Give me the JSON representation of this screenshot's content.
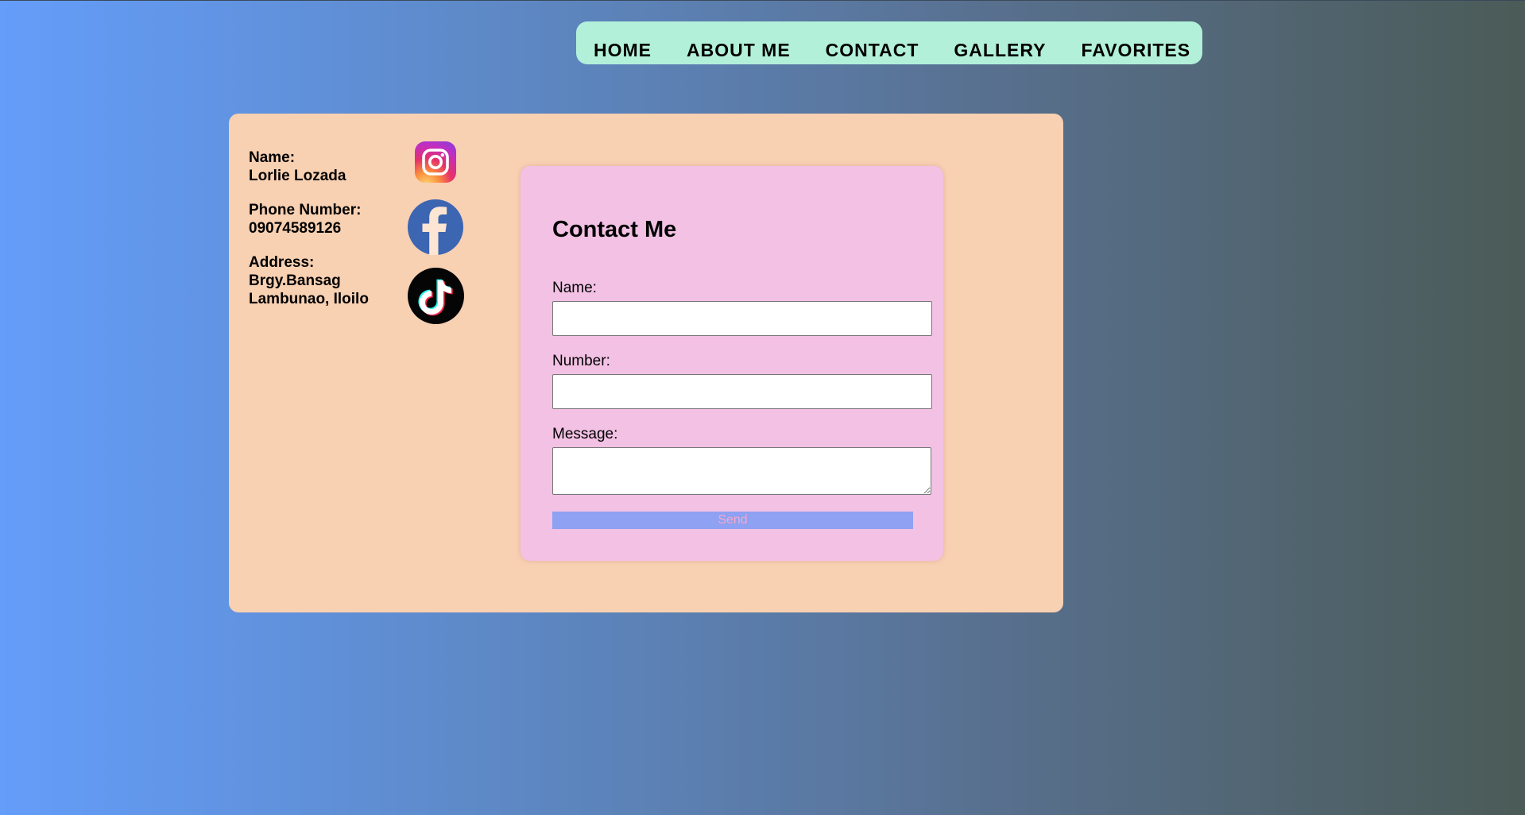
{
  "nav": {
    "items": [
      {
        "label": "HOME"
      },
      {
        "label": "ABOUT ME"
      },
      {
        "label": "CONTACT"
      },
      {
        "label": "GALLERY"
      },
      {
        "label": "FAVORITES"
      }
    ]
  },
  "info": {
    "name_label": "Name:",
    "name_value": "Lorlie Lozada",
    "phone_label": "Phone Number:",
    "phone_value": "09074589126",
    "address_label": "Address:",
    "address_line1": "Brgy.Bansag",
    "address_line2": "Lambunao, Iloilo"
  },
  "social": {
    "icons": [
      "instagram-icon",
      "facebook-icon",
      "tiktok-icon"
    ]
  },
  "form": {
    "title": "Contact Me",
    "name_label": "Name:",
    "name_value": "",
    "number_label": "Number:",
    "number_value": "",
    "message_label": "Message:",
    "message_value": "",
    "send_label": "Send"
  },
  "colors": {
    "nav_background": "#b2f0da",
    "card_background": "#f8d0b2",
    "form_background": "#f2c1e4",
    "send_button": "#8fa1f2",
    "send_text": "#f2a8cc"
  }
}
